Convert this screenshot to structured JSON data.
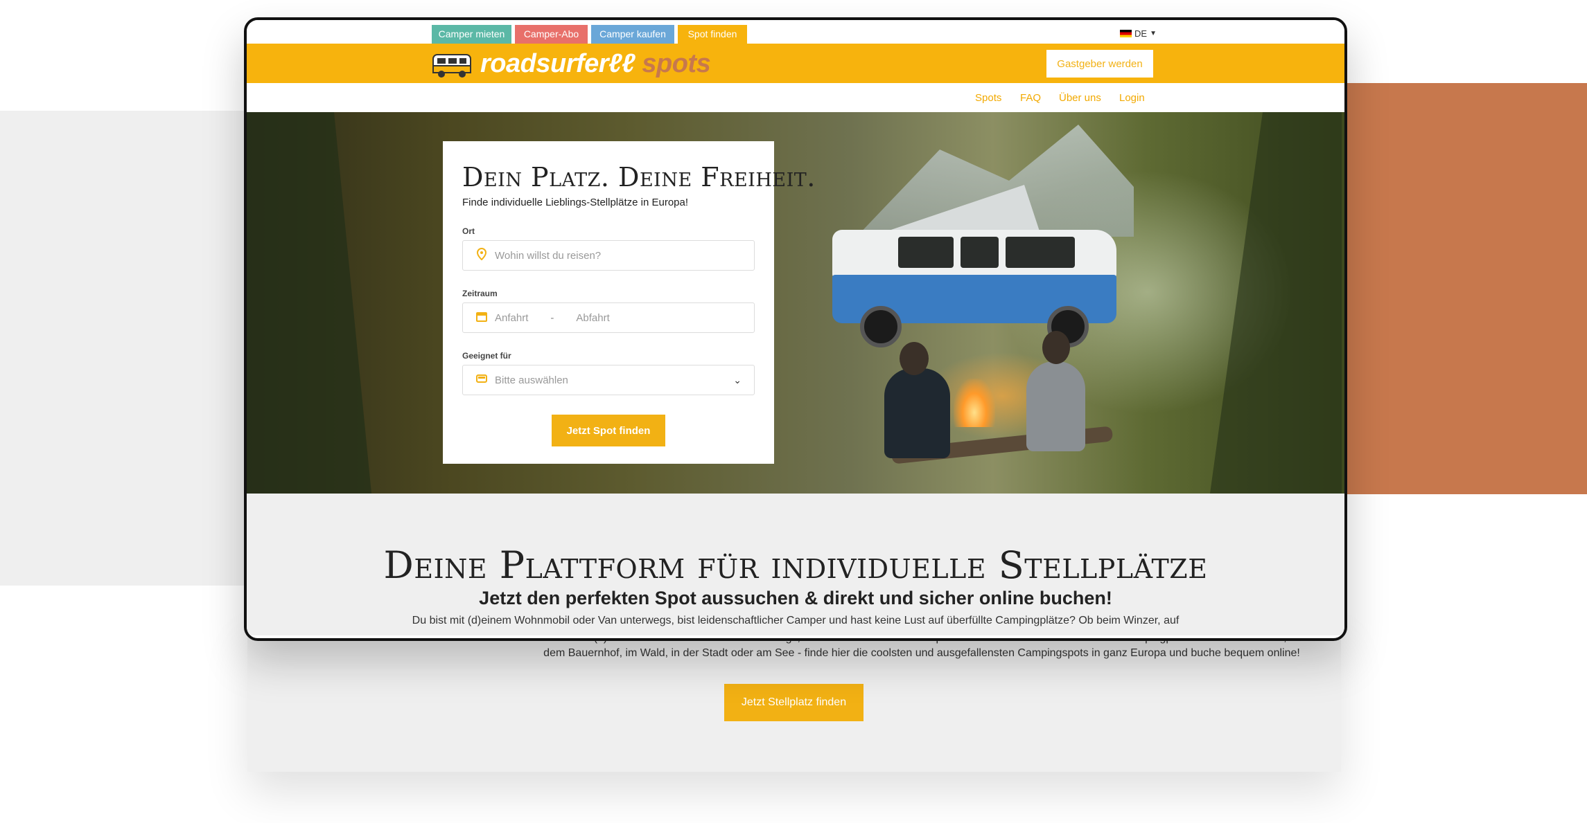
{
  "topnav": {
    "tabs": [
      {
        "label": "Camper mieten",
        "color": "#5bb8a6"
      },
      {
        "label": "Camper-Abo",
        "color": "#e8706a"
      },
      {
        "label": "Camper kaufen",
        "color": "#6aa7d8"
      },
      {
        "label": "Spot finden",
        "color": "#f7b30d"
      }
    ],
    "language": "DE"
  },
  "header": {
    "logo_text": "roadsurfer",
    "logo_sub": "spots",
    "host_button": "Gastgeber werden",
    "nav": [
      "Spots",
      "FAQ",
      "Über uns",
      "Login"
    ]
  },
  "search": {
    "title": "Dein Platz. Deine Freiheit.",
    "subtitle": "Finde individuelle Lieblings-Stellplätze in Europa!",
    "location_label": "Ort",
    "location_placeholder": "Wohin willst du reisen?",
    "period_label": "Zeitraum",
    "arrival_placeholder": "Anfahrt",
    "separator": "-",
    "departure_placeholder": "Abfahrt",
    "suitable_label": "Geeignet für",
    "suitable_value": "Bitte auswählen",
    "submit": "Jetzt Spot finden"
  },
  "platform": {
    "title": "Deine Plattform für individuelle Stellplätze",
    "subtitle": "Jetzt den perfekten Spot aussuchen & direkt und sicher online buchen!",
    "text_line1": "Du bist mit (d)einem Wohnmobil oder Van unterwegs, bist leidenschaftlicher Camper und hast keine Lust auf überfüllte Campingplätze? Ob beim Winzer, auf",
    "text_line2": "dem Bauernhof, im Wald, in der Stadt oder am See - finde hier die coolsten und ausgefallensten Campingspots in ganz Europa und buche bequem online!",
    "cta": "Jetzt Stellplatz finden"
  },
  "colors": {
    "brand_yellow": "#f7b30d",
    "accent_orange": "#c7784d"
  }
}
